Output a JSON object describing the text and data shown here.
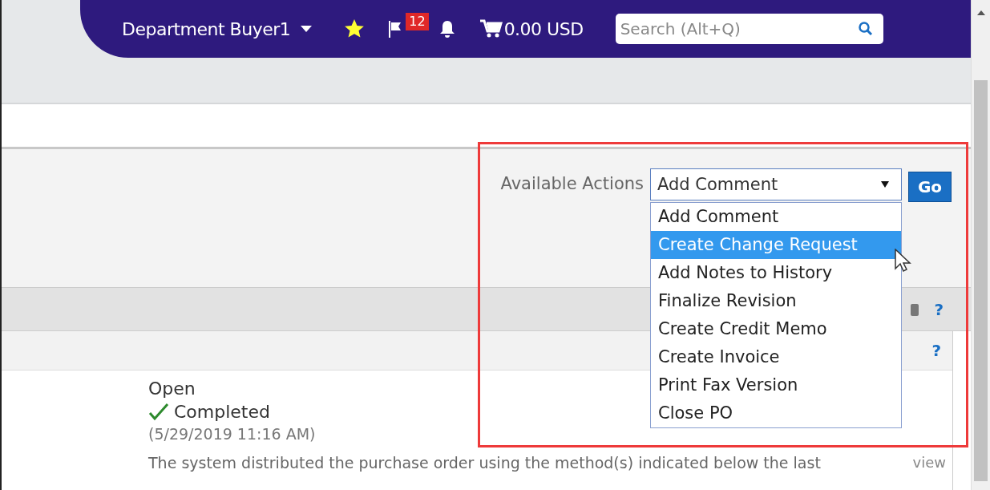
{
  "header": {
    "user": "Department Buyer1",
    "flag_count": "12",
    "cart_total": "0.00 USD",
    "search": {
      "placeholder": "Search (Alt+Q)"
    }
  },
  "actions": {
    "label": "Available Actions",
    "value": "Add Comment",
    "go": "Go",
    "expanded": true,
    "options": [
      {
        "label": "Add Comment",
        "highlighted": false
      },
      {
        "label": "Create Change Request",
        "highlighted": true
      },
      {
        "label": "Add Notes to History",
        "highlighted": false
      },
      {
        "label": "Finalize Revision",
        "highlighted": false
      },
      {
        "label": "Create Credit Memo",
        "highlighted": false
      },
      {
        "label": "Create Invoice",
        "highlighted": false
      },
      {
        "label": "Print Fax Version",
        "highlighted": false
      },
      {
        "label": "Close PO",
        "highlighted": false
      }
    ]
  },
  "panel": {
    "help": "?",
    "subhelp": "?"
  },
  "status": {
    "state": "Open",
    "step": "Completed",
    "completed": true,
    "date": "(5/29/2019 11:16 AM)",
    "description": "The system distributed the purchase order using the method(s) indicated below the last",
    "link": "view"
  }
}
